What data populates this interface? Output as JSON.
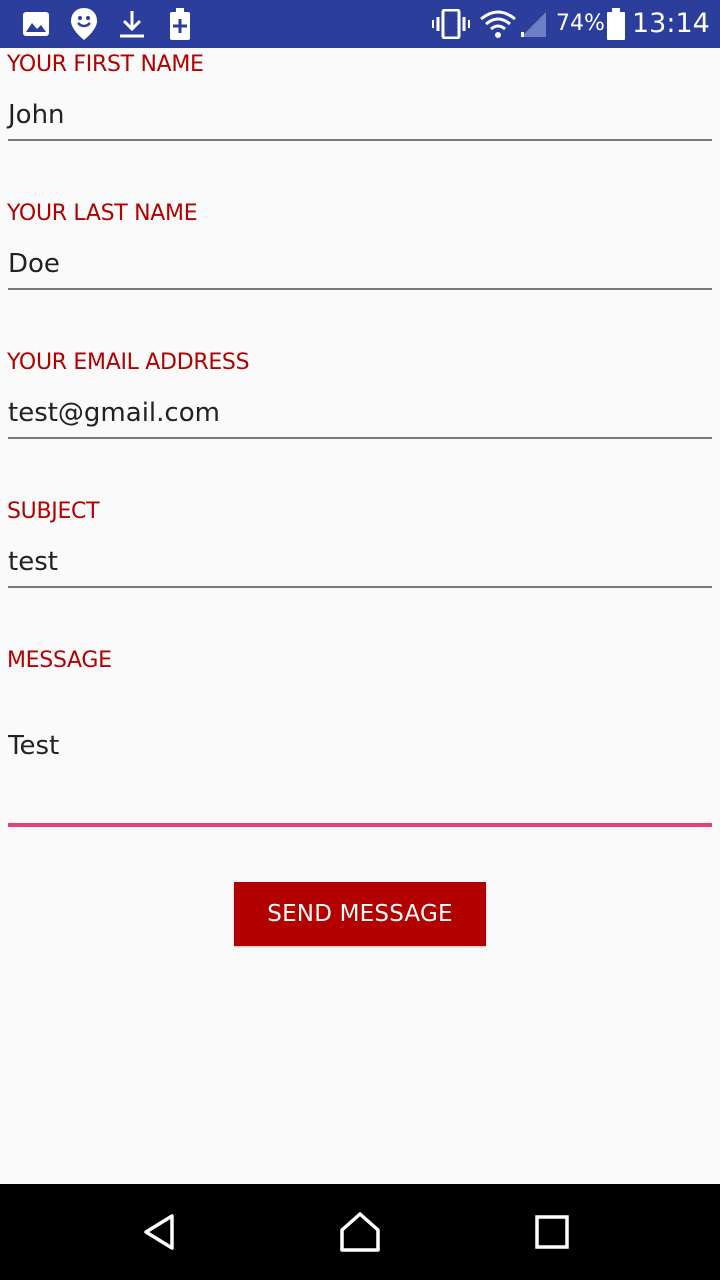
{
  "status_bar": {
    "battery_percent": "74%",
    "time": "13:14",
    "left_icons": [
      "image-icon",
      "smiley-location-icon",
      "download-icon",
      "battery-plus-icon"
    ],
    "right_icons": [
      "vibrate-icon",
      "wifi-icon",
      "signal-icon",
      "battery-icon"
    ],
    "background_color": "#2c3e9c"
  },
  "form": {
    "first_name": {
      "label": "YOUR FIRST NAME",
      "value": "John"
    },
    "last_name": {
      "label": "YOUR LAST NAME",
      "value": "Doe"
    },
    "email": {
      "label": "YOUR EMAIL ADDRESS",
      "value": "test@gmail.com"
    },
    "subject": {
      "label": "SUBJECT",
      "value": "test"
    },
    "message": {
      "label": "MESSAGE",
      "value": "Test"
    },
    "send_label": "SEND MESSAGE",
    "label_color": "#b30000",
    "accent_color": "#e8417a",
    "button_color": "#b30000"
  },
  "nav_bar": {
    "buttons": [
      "back-icon",
      "home-icon",
      "recents-icon"
    ]
  }
}
